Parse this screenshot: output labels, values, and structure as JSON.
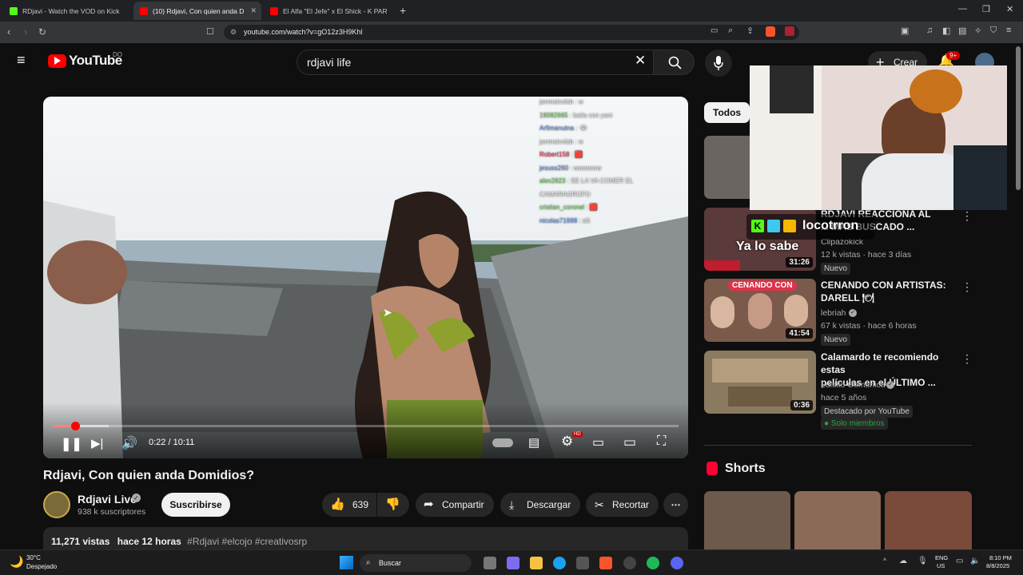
{
  "browser": {
    "tabs": [
      {
        "label": "RDjavi - Watch the VOD on Kick",
        "color": "#53fc18"
      },
      {
        "label": "(10) Rdjavi, Con quien anda D",
        "color": "#ff0000"
      },
      {
        "label": "El Alfa \"El Jefe\" x El Shick - K PARA D",
        "color": "#ff0000"
      }
    ],
    "url": "youtube.com/watch?v=gO12z3H9Khl"
  },
  "yt_header": {
    "logo_text": "YouTube",
    "country": "DO",
    "search_value": "rdjavi life",
    "create_label": "Crear",
    "notif_count": "9+"
  },
  "player": {
    "chat": [
      {
        "user": "janmaicolsb",
        "msg": ": w",
        "color": "#e6e6e6"
      },
      {
        "user": "19082665",
        "msg": ": baila con yani",
        "color": "#7ad86a"
      },
      {
        "user": "Arfimanutna",
        "msg": ": 👁",
        "color": "#6f9ce8"
      },
      {
        "user": "janmaicolsb",
        "msg": ": w",
        "color": "#e6e6e6"
      },
      {
        "user": "Robert158",
        "msg": ": 🟥",
        "color": "#e0485b"
      },
      {
        "user": "jesuss260",
        "msg": ": wwwwww",
        "color": "#6f9ce8"
      },
      {
        "user": "alex2823",
        "msg": ": SE LA VA COMER EL",
        "color": "#7ad86a"
      },
      {
        "user": "",
        "msg": "CAMARAGROFO",
        "color": "#e6e6e6"
      },
      {
        "user": "cristian_coronel",
        "msg": ": 🟥",
        "color": "#7ad86a"
      },
      {
        "user": "nicolas71998",
        "msg": ": slii",
        "color": "#6f9ce8"
      }
    ],
    "time": "0:22 / 10:11",
    "progress": 0.036
  },
  "video": {
    "title": "Rdjavi, Con quien anda Domidios?",
    "channel": "Rdjavi Live",
    "subscribers": "938 k suscriptores",
    "subscribe_label": "Suscribirse",
    "likes": "639",
    "share_label": "Compartir",
    "download_label": "Descargar",
    "clip_label": "Recortar",
    "desc_views": "11,271 vistas",
    "desc_age": "hace 12 horas",
    "desc_tags": "#Rdjavi #elcojo #creativosrp"
  },
  "sidebar": {
    "chip": "Todos",
    "items": [
      {
        "title_line1": "RDJAVI REACCIONA AL",
        "title_line2": "... MAS BUSCADO ...",
        "channel": "Clipazokick",
        "meta": "12 k vistas · hace 3 días",
        "badge": "Nuevo",
        "duration": "31:26",
        "overlay": "Ya lo sabe",
        "thumb_color": "#5a3a3a"
      },
      {
        "title_line1": "CENANDO CON ARTISTAS:",
        "title_line2": "DARELL 🍽",
        "channel": "lebriah",
        "meta": "67 k vistas · hace 6 horas",
        "badge": "Nuevo",
        "duration": "41:54",
        "overlay": "CENANDO CON",
        "thumb_color": "#7a5a4a"
      },
      {
        "title_line1": "Calamardo te recomiendo estas",
        "title_line2": "películas en el ÚLTIMO ...",
        "channel": "Luisito Comunica",
        "meta": "hace 5 años",
        "badge": "Destacado por YouTube",
        "badge2": "Solo miembros",
        "duration": "0:36",
        "thumb_color": "#8a7a60"
      }
    ],
    "shorts_label": "Shorts"
  },
  "overlay": {
    "streamer_name": "locotrron"
  },
  "taskbar": {
    "temp": "30°C",
    "weather": "Despejado",
    "search_label": "Buscar",
    "lang1": "ENG",
    "lang2": "US",
    "time": "8:10 PM",
    "date": "8/8/2025"
  }
}
